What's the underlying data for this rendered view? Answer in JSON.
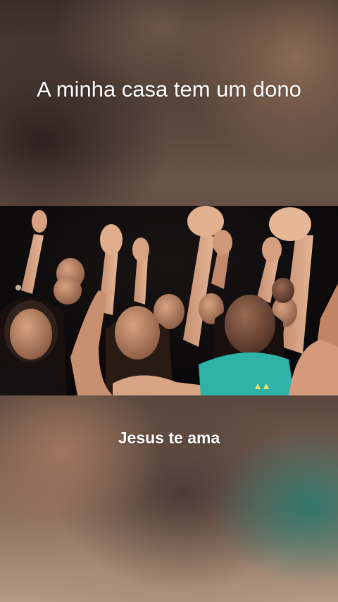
{
  "post": {
    "headline": "A minha casa tem um dono",
    "caption": "Jesus te ama"
  },
  "media": {
    "type": "video-frame",
    "scene": "worship-crowd",
    "accent_colors": {
      "shirt": "#2fb3a6",
      "skin": "#b07a5c",
      "background": "#07070a"
    }
  }
}
